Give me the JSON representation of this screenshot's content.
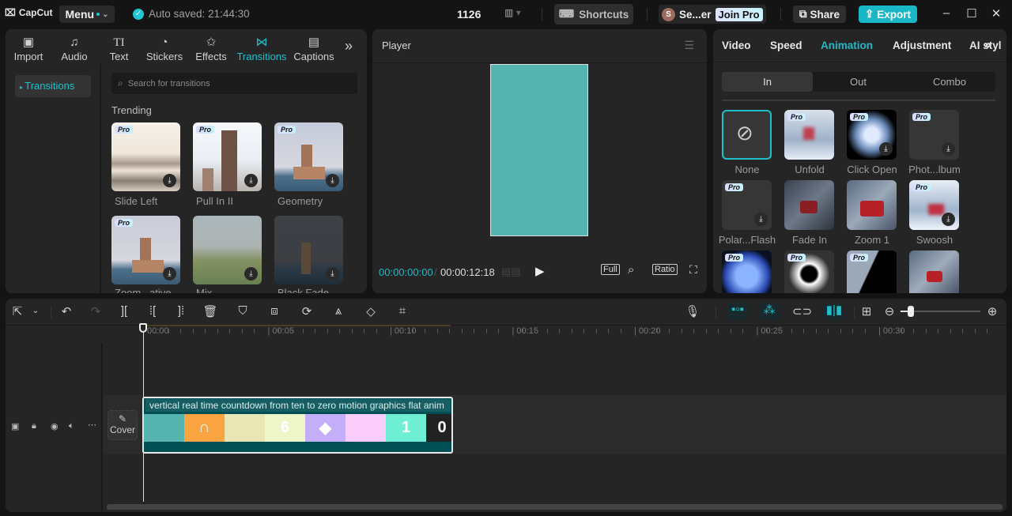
{
  "topbar": {
    "app_name": "CapCut",
    "menu_label": "Menu",
    "autosave_text": "Auto saved: 21:44:30",
    "project_name": "1126",
    "shortcuts_label": "Shortcuts",
    "user_initial": "S",
    "user_name": "Se...er",
    "join_pro_label": "Join Pro",
    "share_label": "Share",
    "export_label": "Export",
    "accent_color": "#1ab7c7"
  },
  "media": {
    "tabs": [
      {
        "label": "Import",
        "icon": "import-icon"
      },
      {
        "label": "Audio",
        "icon": "audio-icon"
      },
      {
        "label": "Text",
        "icon": "text-icon"
      },
      {
        "label": "Stickers",
        "icon": "stickers-icon"
      },
      {
        "label": "Effects",
        "icon": "effects-icon"
      },
      {
        "label": "Transitions",
        "icon": "transitions-icon",
        "active": true
      },
      {
        "label": "Captions",
        "icon": "captions-icon"
      }
    ],
    "sidebar_item": "Transitions",
    "search_placeholder": "Search for transitions",
    "section_title": "Trending",
    "items": [
      {
        "label": "Slide Left",
        "pro": true
      },
      {
        "label": "Pull In II",
        "pro": true
      },
      {
        "label": "Geometry",
        "pro": true
      },
      {
        "label": "Zoom...ative",
        "pro": true
      },
      {
        "label": "Mix",
        "pro": false
      },
      {
        "label": "Black Fade",
        "pro": false
      }
    ],
    "pro_badge": "Pro"
  },
  "player": {
    "title": "Player",
    "current_time": "00:00:00:00",
    "separator": "/",
    "duration": "00:00:12:18",
    "full_label": "Full",
    "ratio_label": "Ratio",
    "canvas_color": "#55b4b0"
  },
  "properties": {
    "tabs": [
      "Video",
      "Speed",
      "Animation",
      "Adjustment",
      "AI styliz"
    ],
    "active_tab": "Animation",
    "segments": [
      "In",
      "Out",
      "Combo"
    ],
    "active_segment": "In",
    "animations": [
      {
        "label": "None",
        "pro": false,
        "selected": true
      },
      {
        "label": "Unfold",
        "pro": true
      },
      {
        "label": "Click Open",
        "pro": true
      },
      {
        "label": "Phot...lbum",
        "pro": true
      },
      {
        "label": "Polar...Flash",
        "pro": true
      },
      {
        "label": "Fade In",
        "pro": false
      },
      {
        "label": "Zoom 1",
        "pro": false
      },
      {
        "label": "Swoosh",
        "pro": true
      },
      {
        "label": "",
        "pro": true
      },
      {
        "label": "",
        "pro": true
      },
      {
        "label": "",
        "pro": true
      },
      {
        "label": "",
        "pro": false
      }
    ]
  },
  "timeline": {
    "ruler": [
      "00:00",
      "00:05",
      "00:10",
      "00:15",
      "00:20",
      "00:25",
      "00:30"
    ],
    "clip_title": "vertical real time countdown from ten to zero motion graphics flat anim",
    "cover_label": "Cover",
    "frames": [
      {
        "text": "",
        "color": "#55b4b0"
      },
      {
        "text": "∩",
        "color": "#f9a440"
      },
      {
        "text": "",
        "color": "#e8e6b4"
      },
      {
        "text": "6",
        "color": "#eef5c8"
      },
      {
        "text": "◆",
        "color": "#c4aef9"
      },
      {
        "text": "",
        "color": "#fccdfb"
      },
      {
        "text": "1",
        "color": "#6eeed2"
      },
      {
        "text": "0",
        "color": "#222222"
      }
    ]
  }
}
